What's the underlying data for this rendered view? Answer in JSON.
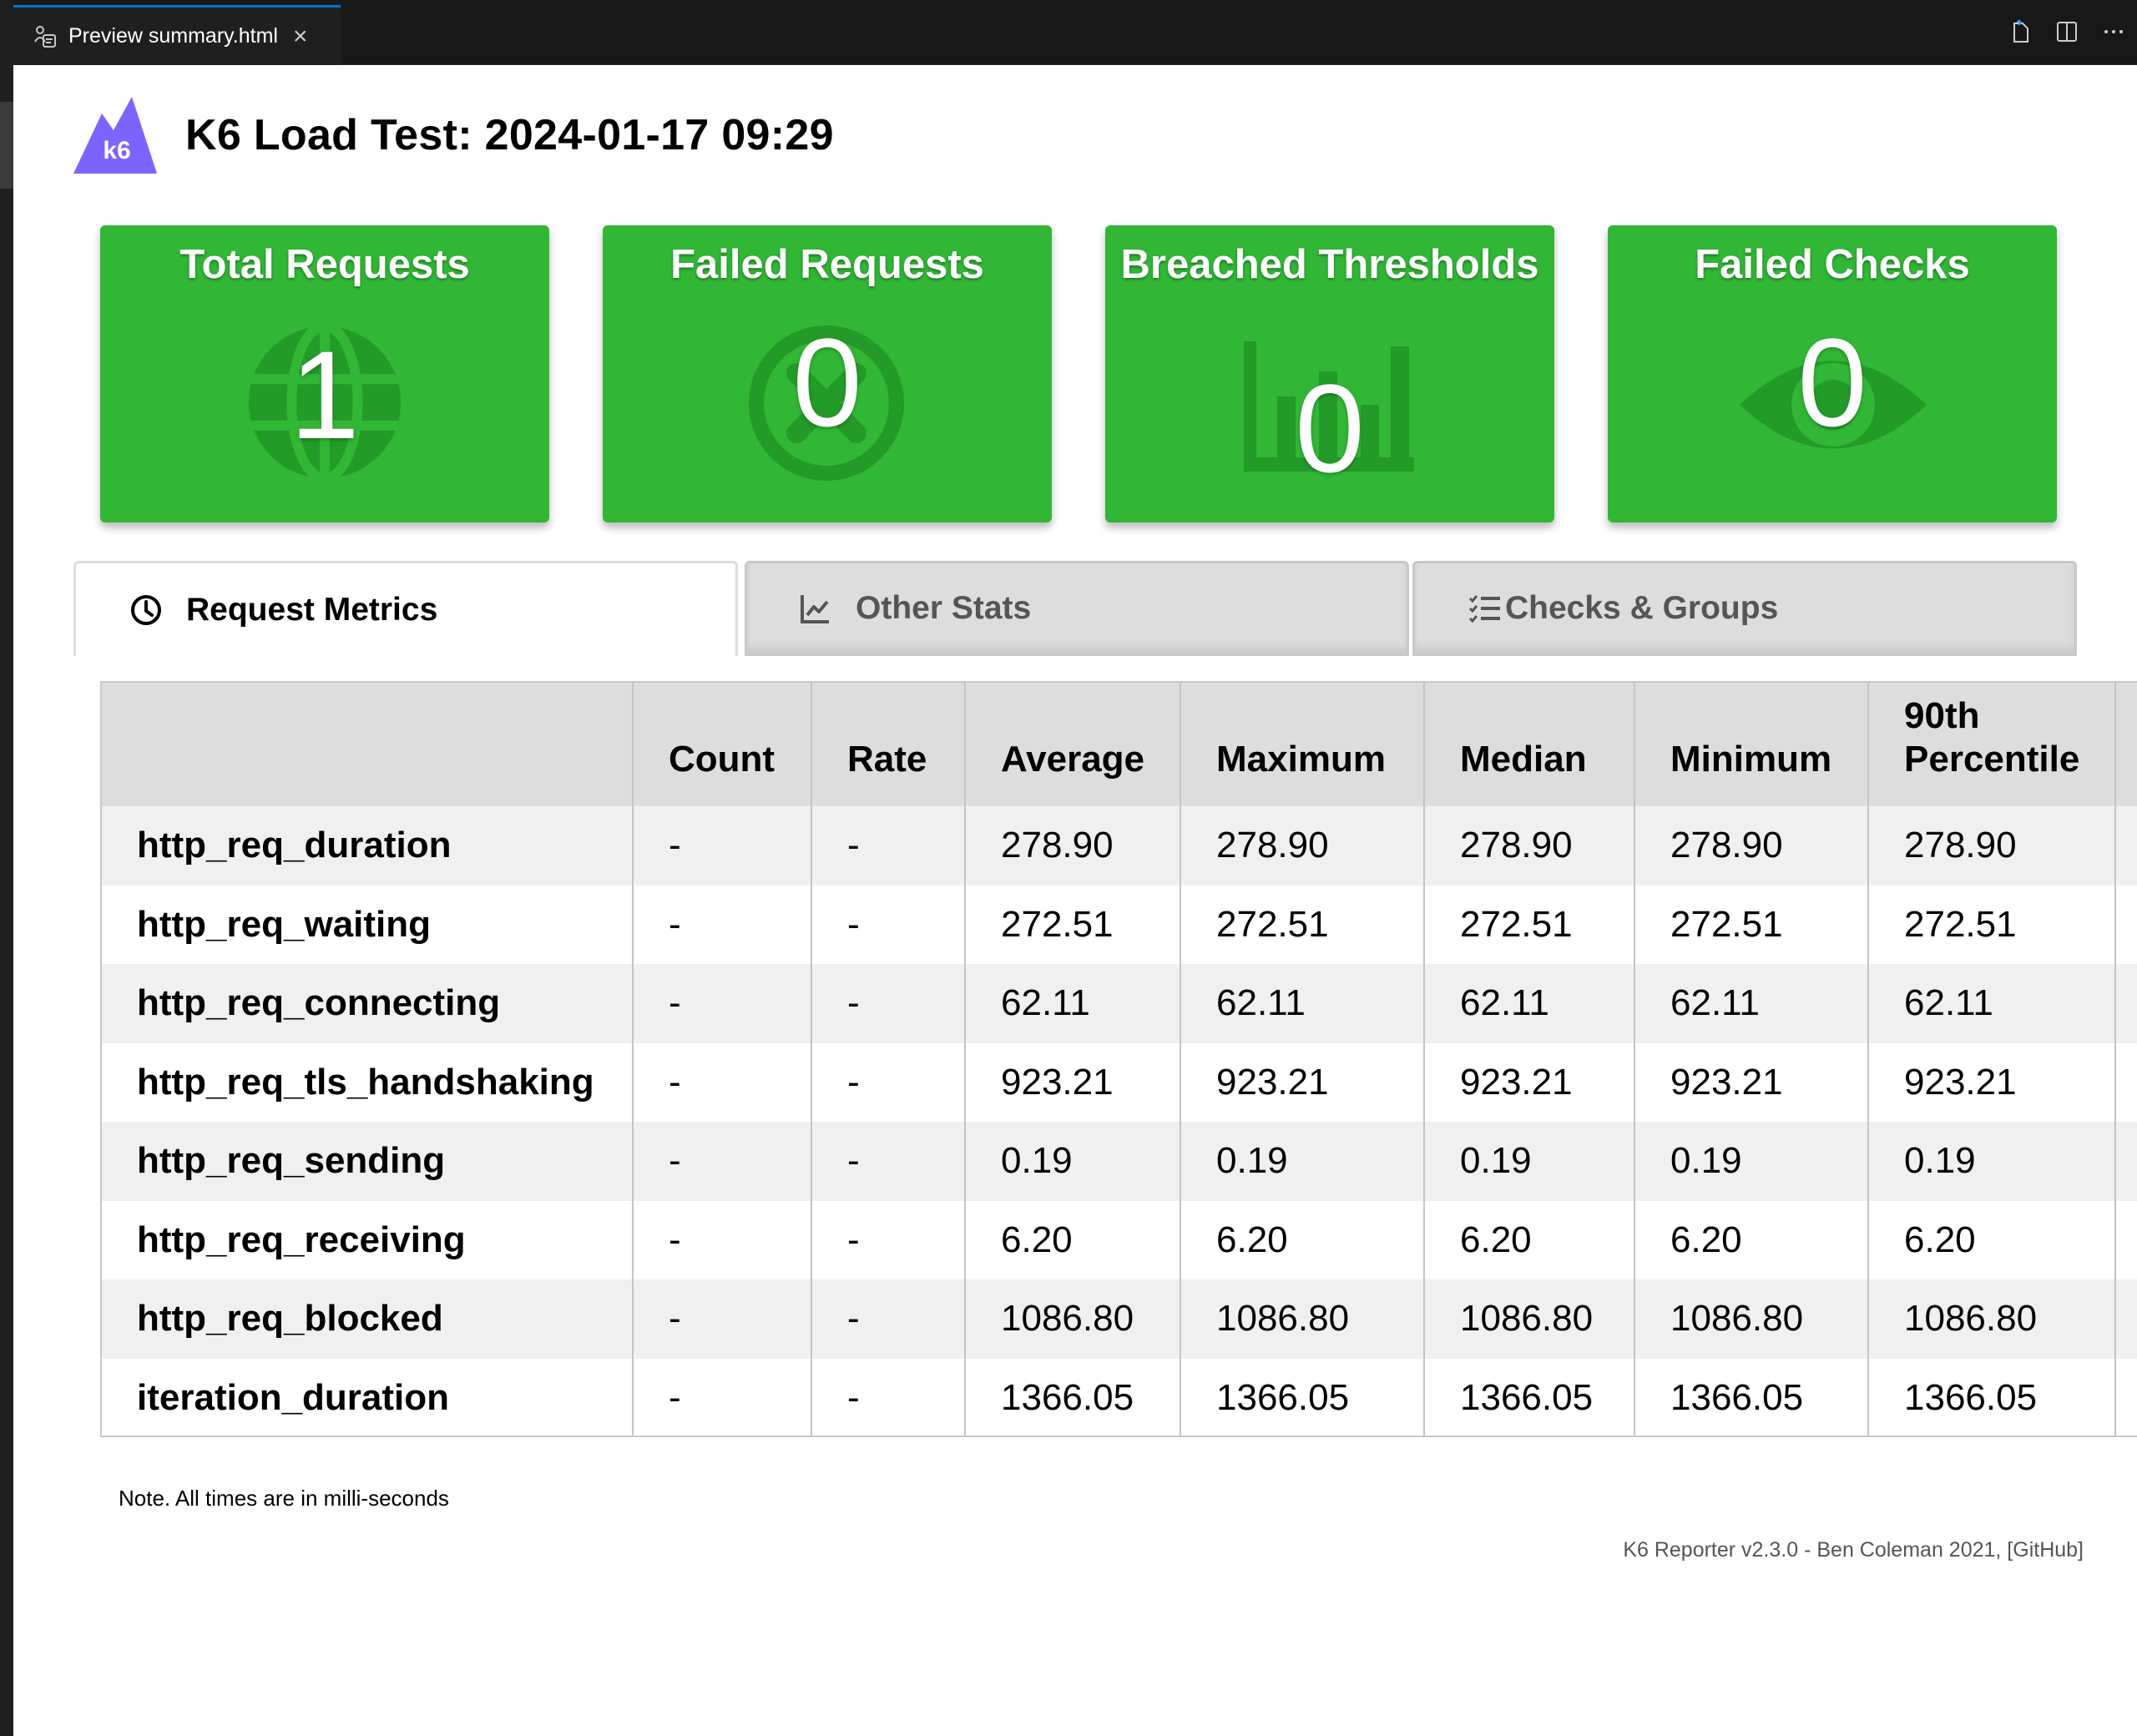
{
  "editor": {
    "tab_title": "Preview summary.html",
    "tab_close": "×",
    "actions": [
      "open-preview-source-icon",
      "split-editor-icon",
      "more-actions-icon"
    ]
  },
  "header": {
    "logo_text": "k6",
    "title": "K6 Load Test: 2024-01-17 09:29"
  },
  "cards": [
    {
      "title": "Total Requests",
      "value": "1",
      "icon": "globe-icon"
    },
    {
      "title": "Failed Requests",
      "value": "0",
      "icon": "circle-x-icon"
    },
    {
      "title": "Breached Thresholds",
      "value": "0",
      "icon": "bar-chart-icon"
    },
    {
      "title": "Failed Checks",
      "value": "0",
      "icon": "eye-icon"
    }
  ],
  "tabs": [
    {
      "label": "Request Metrics",
      "icon": "clock-icon",
      "active": true
    },
    {
      "label": "Other Stats",
      "icon": "line-chart-icon",
      "active": false
    },
    {
      "label": "Checks & Groups",
      "icon": "checklist-icon",
      "active": false
    }
  ],
  "table": {
    "columns": [
      "",
      "Count",
      "Rate",
      "Average",
      "Maximum",
      "Median",
      "Minimum",
      "90th Percentile"
    ],
    "rows": [
      [
        "http_req_duration",
        "-",
        "-",
        "278.90",
        "278.90",
        "278.90",
        "278.90",
        "278.90"
      ],
      [
        "http_req_waiting",
        "-",
        "-",
        "272.51",
        "272.51",
        "272.51",
        "272.51",
        "272.51"
      ],
      [
        "http_req_connecting",
        "-",
        "-",
        "62.11",
        "62.11",
        "62.11",
        "62.11",
        "62.11"
      ],
      [
        "http_req_tls_handshaking",
        "-",
        "-",
        "923.21",
        "923.21",
        "923.21",
        "923.21",
        "923.21"
      ],
      [
        "http_req_sending",
        "-",
        "-",
        "0.19",
        "0.19",
        "0.19",
        "0.19",
        "0.19"
      ],
      [
        "http_req_receiving",
        "-",
        "-",
        "6.20",
        "6.20",
        "6.20",
        "6.20",
        "6.20"
      ],
      [
        "http_req_blocked",
        "-",
        "-",
        "1086.80",
        "1086.80",
        "1086.80",
        "1086.80",
        "1086.80"
      ],
      [
        "iteration_duration",
        "-",
        "-",
        "1366.05",
        "1366.05",
        "1366.05",
        "1366.05",
        "1366.05"
      ]
    ]
  },
  "note": "Note. All times are in milli-seconds",
  "footer": "K6 Reporter v2.3.0 - Ben Coleman 2021, [GitHub]",
  "colors": {
    "card_green": "#31b636",
    "logo_purple": "#7d64ff",
    "tab_accent": "#0078d4"
  }
}
